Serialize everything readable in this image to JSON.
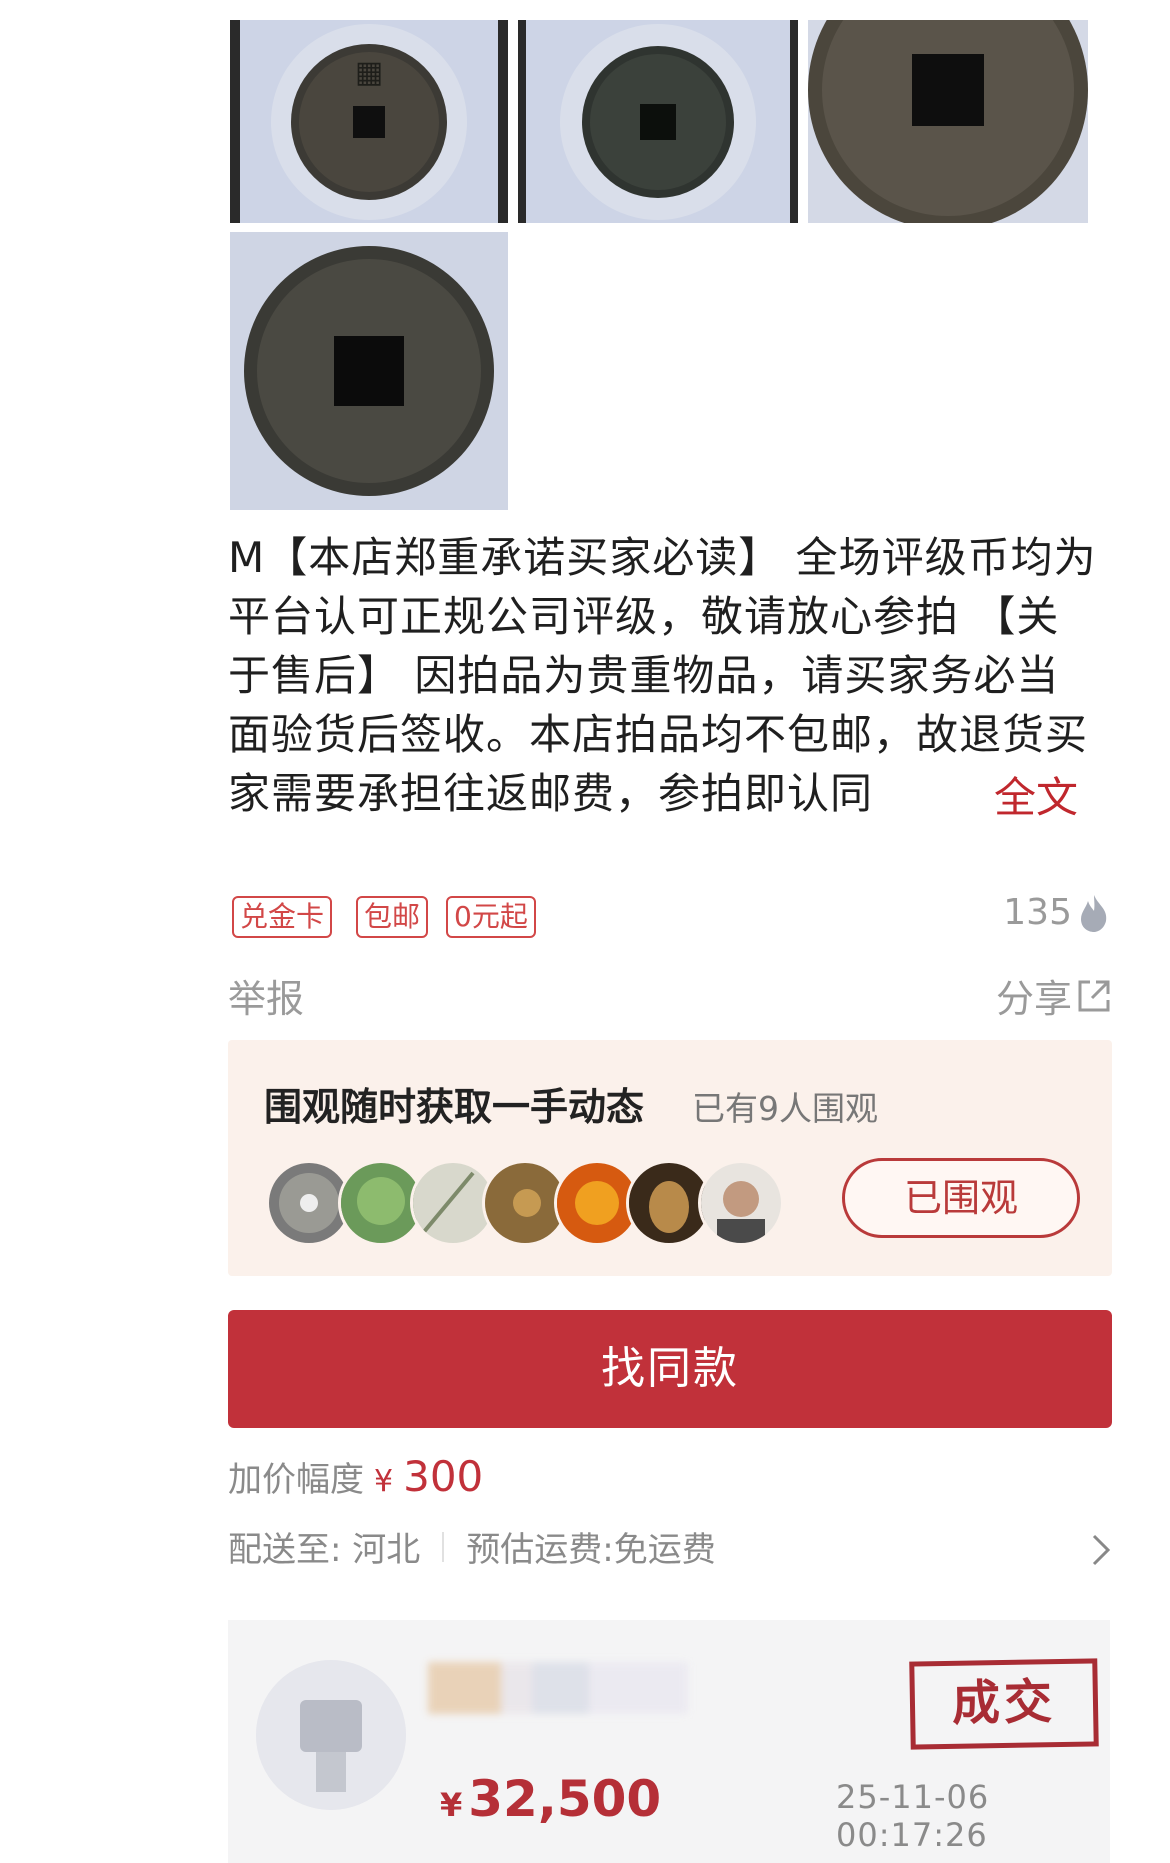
{
  "description": {
    "text": "M【本店郑重承诺买家必读】 全场评级币均为平台认可正规公司评级，敬请放心参拍 【关于售后】 因拍品为贵重物品，请买家务必当面验货后签收。本店拍品均不包邮，故退货买家需要承担往返邮费，参拍即认同",
    "more_label": "全文"
  },
  "tags": [
    "兑金卡",
    "包邮",
    "0元起"
  ],
  "likes": {
    "count": "135",
    "icon": "flame-icon"
  },
  "report_label": "举报",
  "share": {
    "label": "分享",
    "icon": "share-icon"
  },
  "watch": {
    "title": "围观随时获取一手动态",
    "count_text": "已有9人围观",
    "button_label": "已围观",
    "avatar_colors": [
      "#7a7a7a",
      "#6b9a5a",
      "#c8c8bc",
      "#8a6a3a",
      "#d65a10",
      "#3a2a1a",
      "#b9b0a6"
    ]
  },
  "find_same_label": "找同款",
  "increment": {
    "label": "加价幅度",
    "currency": "¥",
    "value": "300"
  },
  "shipping": {
    "to_label": "配送至: 河北",
    "fee_label": "预估运费:免运费"
  },
  "deal": {
    "currency": "¥",
    "price": "32,500",
    "stamp": "成交",
    "time": "25-11-06 00:17:26"
  },
  "colors": {
    "accent": "#c1313a",
    "card_bg": "#fbf1eb"
  }
}
